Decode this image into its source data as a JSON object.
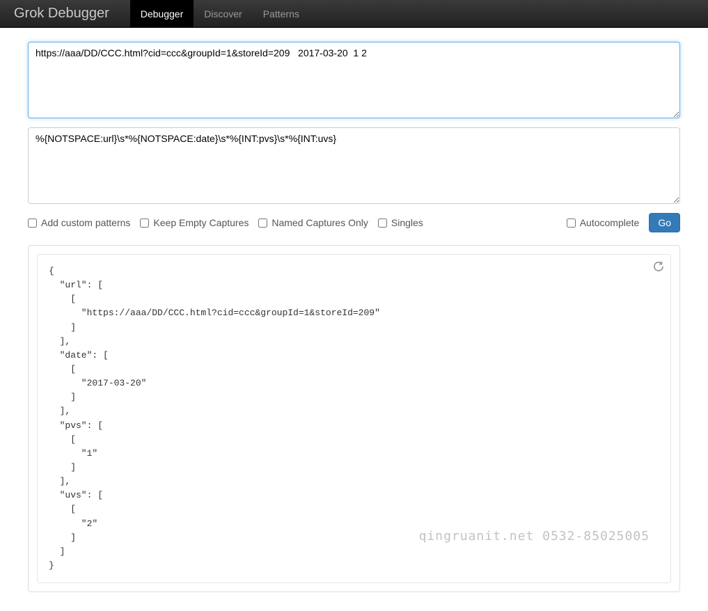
{
  "navbar": {
    "brand": "Grok Debugger",
    "items": [
      {
        "label": "Debugger",
        "active": true
      },
      {
        "label": "Discover",
        "active": false
      },
      {
        "label": "Patterns",
        "active": false
      }
    ]
  },
  "inputs": {
    "sample_text": "https://aaa/DD/CCC.html?cid=ccc&groupId=1&storeId=209   2017-03-20  1 2",
    "pattern_text": "%{NOTSPACE:url}\\s*%{NOTSPACE:date}\\s*%{INT:pvs}\\s*%{INT:uvs}"
  },
  "options": {
    "add_custom_patterns": {
      "label": "Add custom patterns",
      "checked": false
    },
    "keep_empty_captures": {
      "label": "Keep Empty Captures",
      "checked": false
    },
    "named_captures_only": {
      "label": "Named Captures Only",
      "checked": false
    },
    "singles": {
      "label": "Singles",
      "checked": false
    },
    "autocomplete": {
      "label": "Autocomplete",
      "checked": false
    }
  },
  "buttons": {
    "go": "Go"
  },
  "result_json": "{\n  \"url\": [\n    [\n      \"https://aaa/DD/CCC.html?cid=ccc&groupId=1&storeId=209\"\n    ]\n  ],\n  \"date\": [\n    [\n      \"2017-03-20\"\n    ]\n  ],\n  \"pvs\": [\n    [\n      \"1\"\n    ]\n  ],\n  \"uvs\": [\n    [\n      \"2\"\n    ]\n  ]\n}",
  "watermark": "qingruanit.net 0532-85025005"
}
